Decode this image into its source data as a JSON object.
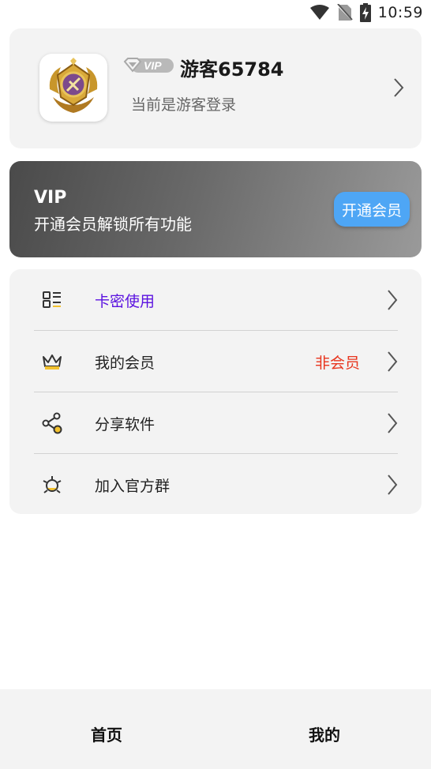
{
  "status_bar": {
    "time": "10:59"
  },
  "profile": {
    "vip_badge_text": "VIP",
    "username": "游客65784",
    "login_status": "当前是游客登录"
  },
  "vip_banner": {
    "title": "VIP",
    "subtitle": "开通会员解锁所有功能",
    "button_label": "开通会员"
  },
  "menu": {
    "items": [
      {
        "label": "卡密使用",
        "value": "",
        "label_color": "#5b12e0",
        "icon": "qr-card-icon"
      },
      {
        "label": "我的会员",
        "value": "非会员",
        "label_color": "#222222",
        "icon": "crown-icon"
      },
      {
        "label": "分享软件",
        "value": "",
        "label_color": "#222222",
        "icon": "share-icon"
      },
      {
        "label": "加入官方群",
        "value": "",
        "label_color": "#222222",
        "icon": "group-icon"
      }
    ]
  },
  "bottom_nav": {
    "items": [
      {
        "label": "首页"
      },
      {
        "label": "我的"
      }
    ]
  },
  "colors": {
    "accent_blue": "#4ea6f5",
    "non_member_red": "#e8351e",
    "highlight_purple": "#5b12e0",
    "icon_gold": "#f2c12e"
  }
}
